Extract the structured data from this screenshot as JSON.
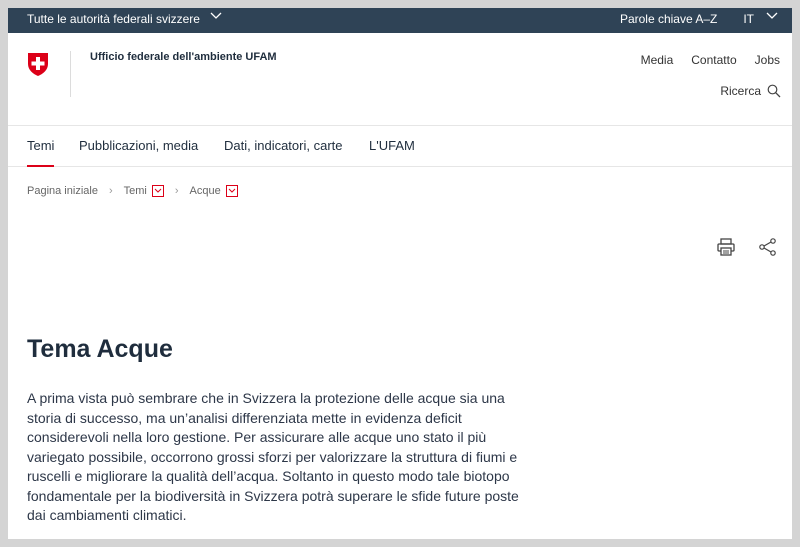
{
  "topbar": {
    "authorities_label": "Tutte le autorità federali svizzere",
    "keywords_label": "Parole chiave A–Z",
    "language": "IT"
  },
  "header": {
    "office_name": "Ufficio federale dell'ambiente UFAM",
    "links": [
      "Media",
      "Contatto",
      "Jobs"
    ],
    "search_label": "Ricerca"
  },
  "nav": {
    "tabs": [
      "Temi",
      "Pubblicazioni, media",
      "Dati, indicatori, carte",
      "L'UFAM"
    ],
    "active": "Temi"
  },
  "breadcrumb": [
    "Pagina iniziale",
    "Temi",
    "Acque"
  ],
  "icons": {
    "print": "print-icon",
    "share": "share-icon",
    "search": "search-icon"
  },
  "colors": {
    "topbar": "#2f4356",
    "accent": "#dc0018"
  },
  "main": {
    "title": "Tema Acque",
    "lead": "A prima vista può sembrare che in Svizzera la protezione delle acque sia una storia di successo, ma un’analisi differenziata mette in evidenza deficit considerevoli nella loro gestione. Per assicurare alle acque uno stato il più variegato possibile, occorrono grossi sforzi per valorizzare la struttura di fiumi e ruscelli e migliorare la qualità dell’acqua. Soltanto in questo modo tale biotopo fondamentale per la biodiversità in Svizzera potrà superare le sfide future poste dai cambiamenti climatici."
  }
}
